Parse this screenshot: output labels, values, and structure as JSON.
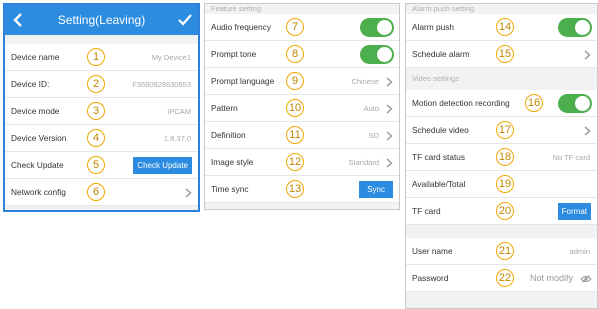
{
  "panel1": {
    "title": "Setting(Leaving)",
    "rows": [
      {
        "label": "Device name",
        "num": "1",
        "value": "My Device1"
      },
      {
        "label": "Device ID:",
        "num": "2",
        "value": "F3690928630653"
      },
      {
        "label": "Device mode",
        "num": "3",
        "value": "IPCAM"
      },
      {
        "label": "Device Version",
        "num": "4",
        "value": "1.8.37.0"
      },
      {
        "label": "Check Update",
        "num": "5",
        "button": "Check Update"
      },
      {
        "label": "Network config",
        "num": "6"
      }
    ]
  },
  "panel2": {
    "section": "Feature setting",
    "rows": [
      {
        "label": "Audio frequency",
        "num": "7",
        "toggle": "on"
      },
      {
        "label": "Prompt tone",
        "num": "8",
        "toggle": "on"
      },
      {
        "label": "Prompt language",
        "num": "9",
        "value": "Chinese"
      },
      {
        "label": "Pattern",
        "num": "10",
        "value": "Auto"
      },
      {
        "label": "Definition",
        "num": "11",
        "value": "SD"
      },
      {
        "label": "Image style",
        "num": "12",
        "value": "Standard"
      },
      {
        "label": "Time sync",
        "num": "13",
        "button": "Sync"
      }
    ]
  },
  "panel3": {
    "alarm_section": "Alarm push setting",
    "video_section": "Video settings",
    "rows": [
      {
        "label": "Alarm push",
        "num": "14",
        "toggle": "on"
      },
      {
        "label": "Schedule alarm",
        "num": "15"
      },
      {
        "label": "Motion detection recording",
        "num": "16",
        "toggle": "on"
      },
      {
        "label": "Schedule video",
        "num": "17"
      },
      {
        "label": "TF card status",
        "num": "18",
        "value": "No TF card"
      },
      {
        "label": "Available/Total",
        "num": "19"
      },
      {
        "label": "TF card",
        "num": "20",
        "button": "Format"
      },
      {
        "label": "User name",
        "num": "21",
        "value": "admin"
      },
      {
        "label": "Password",
        "num": "22",
        "value": "Not modify"
      }
    ]
  },
  "colors": {
    "accent": "#2b8ce0",
    "toggle_on": "#4cae4c",
    "marker": "#f0a800",
    "frame": "#2f80d8"
  },
  "icons": {
    "back": "chevron-left-icon",
    "confirm": "check-icon",
    "row_arrow": "chevron-right-icon",
    "password": "eye-icon"
  }
}
